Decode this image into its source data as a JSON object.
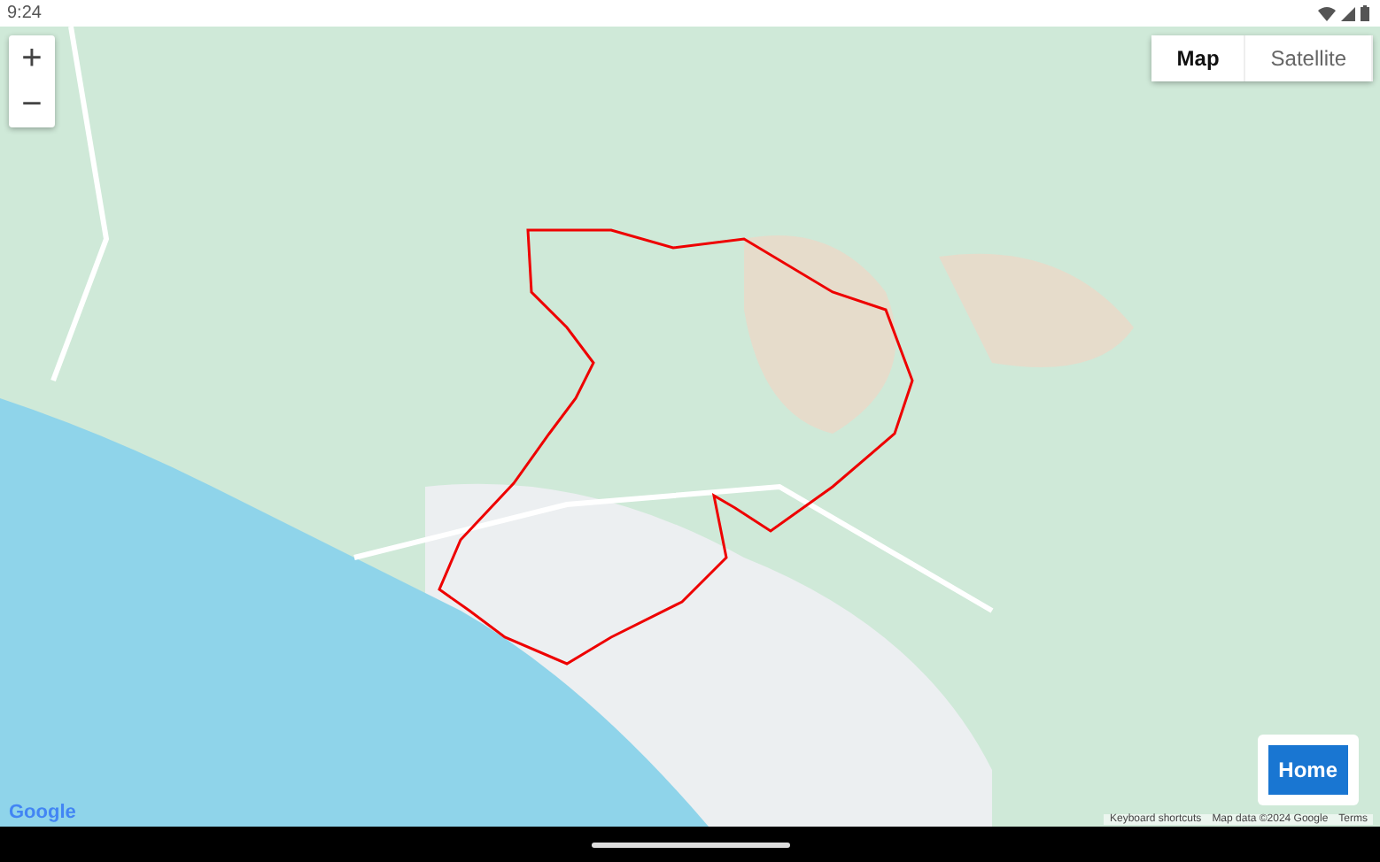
{
  "status_bar": {
    "time": "9:24"
  },
  "map": {
    "zoom_in": "+",
    "zoom_out": "−",
    "map_types": [
      {
        "label": "Map",
        "selected": true
      },
      {
        "label": "Satellite",
        "selected": false
      }
    ],
    "home_button": "Home",
    "logo": "Google",
    "attribution": [
      "Keyboard shortcuts",
      "Map data ©2024 Google",
      "Terms"
    ]
  }
}
